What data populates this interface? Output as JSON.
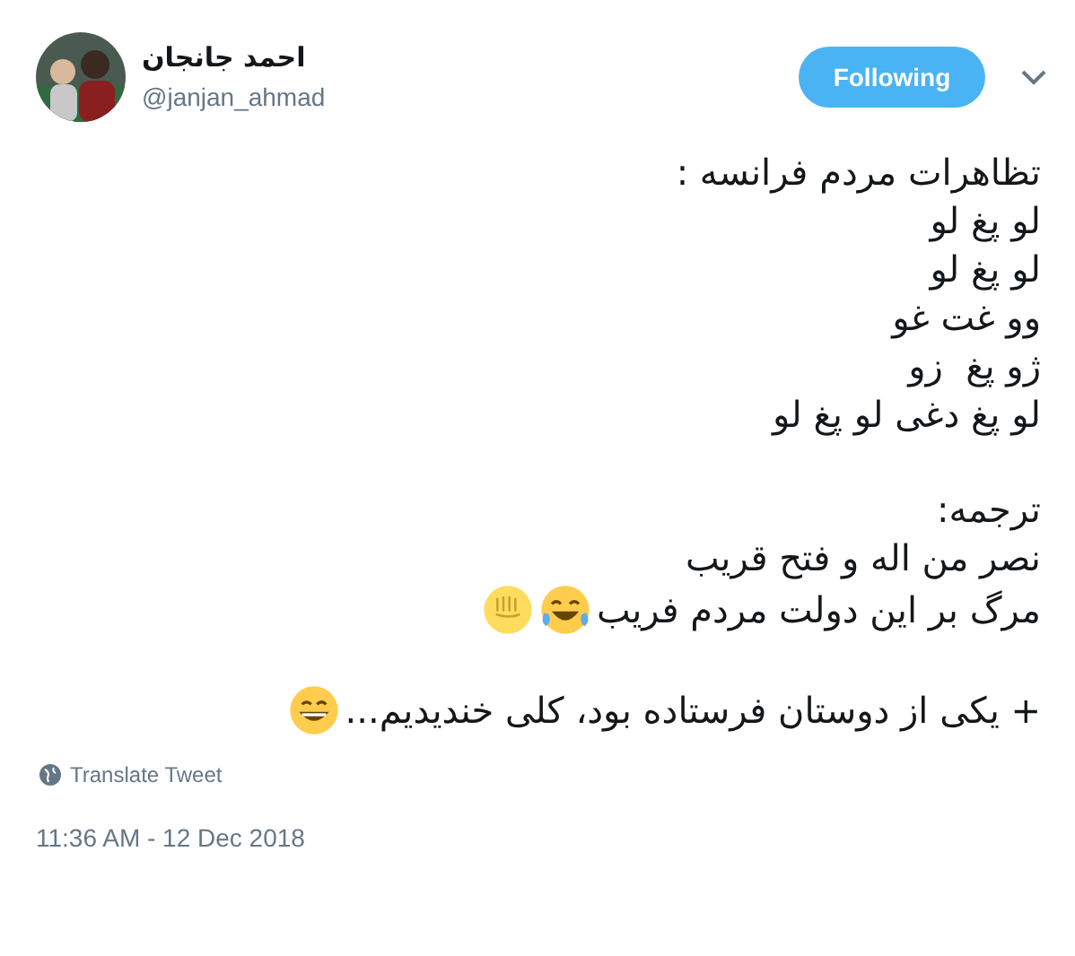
{
  "author": {
    "name": "احمد جانجان",
    "handle": "@janjan_ahmad"
  },
  "follow_button": {
    "label": "Following"
  },
  "paragraphs": [
    [
      "تظاهرات مردم فرانسه :",
      "لو پغ لو",
      "لو پغ لو",
      "وو غت غو",
      "ژو پغ  زو",
      "لو پغ دغی لو پغ لو"
    ],
    [
      "ترجمه:",
      "نصر من اله و فتح قریب",
      "مرگ بر این دولت مردم فریب"
    ],
    [
      "+ یکی از دوستان فرستاده بود، کلی خندیدیم..."
    ]
  ],
  "translate_link": "Translate Tweet",
  "timestamp": "11:36 AM - 12 Dec 2018"
}
